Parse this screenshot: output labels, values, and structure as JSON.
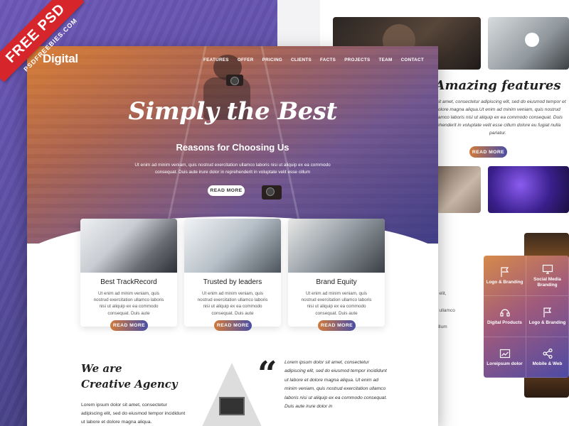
{
  "badge": {
    "title": "FREE PSD",
    "subtitle": "PSDFREEBIES.COM"
  },
  "brand": {
    "logo": "Digital"
  },
  "nav": [
    "FEATURES",
    "OFFER",
    "PRICING",
    "CLIENTS",
    "FACTS",
    "PROJECTS",
    "TEAM",
    "CONTACT"
  ],
  "hero": {
    "title": "Simply the Best",
    "subtitle": "Reasons for Choosing Us",
    "text": "Ut enim ad minim veniam, quis nostrud exercitation ullamco laboris nisi ut aliquip ex ea commodo consequat. Duis aute irure dolor in reprehenderit in voluptate velit esse cillum",
    "button": "READ MORE"
  },
  "cards": [
    {
      "title": "Best TrackRecord",
      "text": "Ut enim ad minim veniam, quis nostrud exercitation ullamco laboris nisi ut aliquip ex ea commodo consequat. Duis aute",
      "button": "READ MORE"
    },
    {
      "title": "Trusted by leaders",
      "text": "Ut enim ad minim veniam, quis nostrud exercitation ullamco laboris nisi ut aliquip ex ea commodo consequat. Duis aute",
      "button": "READ MORE"
    },
    {
      "title": "Brand Equity",
      "text": "Ut enim ad minim veniam, quis nostrud exercitation ullamco laboris nisi ut aliquip ex ea commodo consequat. Duis aute",
      "button": "READ MORE"
    }
  ],
  "about": {
    "heading_line1": "We are",
    "heading_line2": "Creative Agency",
    "text": "Lorem ipsum dolor sit amet, consectetur adipiscing elit, sed do eiusmod tempor incididunt ut labore et dolore magna aliqua.",
    "quote": "Lorem ipsum dolor sit amet, consectetur adipiscing elit, sed do eiusmod tempor incididunt ut labore et dolore magna aliqua. Ut enim ad minim veniam, quis nostrud exercitation ullamco laboris nisi ut aliquip ex ea commodo consequat. Duis aute irure dolor in"
  },
  "features": {
    "heading": "Amazing features",
    "text": "lor sit amet, consectetur adipiscing elit, sed do eiusmod tempor et dolore magna aliqua.Ut enim ad minim veniam, quis nostrud ullamco laboris nisi ut aliquip ex ea commodo consequat. Duis rehenderit in voluptate velit esse cillum dolore eu fugiat nulla pariatur.",
    "button": "READ MORE"
  },
  "side_snippet": [
    "g elit,",
    "",
    "e",
    "",
    "n ullamco",
    "e",
    "cillum",
    "e",
    "e"
  ],
  "services": [
    {
      "label": "Logo & Branding",
      "icon": "flag-icon"
    },
    {
      "label": "Social Media Branding",
      "icon": "monitor-icon"
    },
    {
      "label": "Digital Products",
      "icon": "headset-icon"
    },
    {
      "label": "Logo & Branding",
      "icon": "flag-icon"
    },
    {
      "label": "Loreipsum dolor",
      "icon": "chart-icon"
    },
    {
      "label": "Mobile & Web",
      "icon": "share-icon"
    }
  ]
}
